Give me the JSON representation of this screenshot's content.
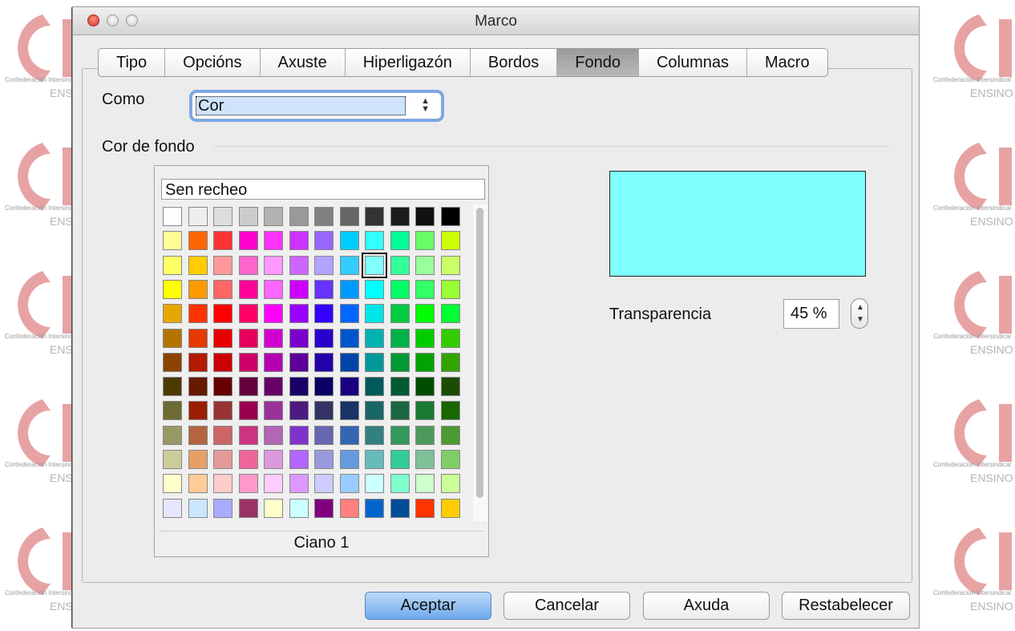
{
  "window": {
    "title": "Marco"
  },
  "tabs": [
    {
      "label": "Tipo",
      "active": false
    },
    {
      "label": "Opcións",
      "active": false
    },
    {
      "label": "Axuste",
      "active": false
    },
    {
      "label": "Hiperligazón",
      "active": false
    },
    {
      "label": "Bordos",
      "active": false
    },
    {
      "label": "Fondo",
      "active": true
    },
    {
      "label": "Columnas",
      "active": false
    },
    {
      "label": "Macro",
      "active": false
    }
  ],
  "como": {
    "label": "Como",
    "value": "Cor"
  },
  "section": {
    "title": "Cor de fondo"
  },
  "palette": {
    "none_label": "Sen recheo",
    "selected_name": "Ciano 1",
    "selected_index": [
      2,
      8
    ],
    "rows": [
      [
        "#ffffff",
        "#eeeeee",
        "#dddddd",
        "#cccccc",
        "#b2b2b2",
        "#999999",
        "#808080",
        "#666666",
        "#333333",
        "#1c1c1c",
        "#111111",
        "#000000"
      ],
      [
        "#ffff99",
        "#ff6600",
        "#ff3333",
        "#ff00cc",
        "#ff33ff",
        "#cc33ff",
        "#9966ff",
        "#00ccff",
        "#33ffff",
        "#00ff99",
        "#66ff66",
        "#ccff00"
      ],
      [
        "#ffff66",
        "#ffcc00",
        "#ff9999",
        "#ff66cc",
        "#ff99ff",
        "#cc66ff",
        "#b2a3ff",
        "#33ccff",
        "#80ffff",
        "#33ff99",
        "#99ff99",
        "#ccff66"
      ],
      [
        "#ffff00",
        "#ff9900",
        "#ff6666",
        "#ff0099",
        "#ff66ff",
        "#cc00ff",
        "#6633ff",
        "#0099ff",
        "#00ffff",
        "#00ff66",
        "#33ff66",
        "#99ff33"
      ],
      [
        "#e6a800",
        "#ff3300",
        "#ff0000",
        "#ff0066",
        "#ff00ff",
        "#9900ff",
        "#3300ff",
        "#0066ff",
        "#00e5e5",
        "#00cc44",
        "#00ff00",
        "#00ff33"
      ],
      [
        "#b37400",
        "#e63900",
        "#e60000",
        "#e6005c",
        "#d100d1",
        "#7a00cc",
        "#2a00cc",
        "#0055cc",
        "#00b2b2",
        "#00b247",
        "#00cc00",
        "#33cc00"
      ],
      [
        "#8a4400",
        "#b31a00",
        "#cc0000",
        "#cc0066",
        "#b300b3",
        "#5c0099",
        "#2200aa",
        "#0044aa",
        "#009999",
        "#009933",
        "#00a300",
        "#33a300"
      ],
      [
        "#4d3a00",
        "#661a00",
        "#660000",
        "#66003d",
        "#660066",
        "#1a0066",
        "#0a0066",
        "#1a0080",
        "#00595b",
        "#005a33",
        "#004d00",
        "#1a4d00"
      ],
      [
        "#6b6b33",
        "#991f00",
        "#993333",
        "#99004d",
        "#993399",
        "#4d1a80",
        "#333366",
        "#1a3366",
        "#1a6666",
        "#1a6640",
        "#1a7a33",
        "#1a6600"
      ],
      [
        "#999966",
        "#b3663d",
        "#cc6666",
        "#cc3380",
        "#b366b3",
        "#8033cc",
        "#6666b3",
        "#3366b3",
        "#338080",
        "#33995c",
        "#4d995c",
        "#4d9933"
      ],
      [
        "#cccc99",
        "#e6a066",
        "#e69999",
        "#ee6699",
        "#dd99dd",
        "#b366ff",
        "#9999dd",
        "#6699dd",
        "#66bbbb",
        "#33cc99",
        "#80c099",
        "#80cc66"
      ],
      [
        "#ffffcc",
        "#ffcc99",
        "#ffcccc",
        "#ff99cc",
        "#ffccff",
        "#dd99ff",
        "#ccccff",
        "#99ccff",
        "#ccffff",
        "#80ffcc",
        "#ccffcc",
        "#ccff99"
      ],
      [
        "#e6e6ff",
        "#cce6ff",
        "#aaaaff",
        "#993366",
        "#ffffcc",
        "#ccffff",
        "#800080",
        "#ff8080",
        "#0066cc",
        "#004c99",
        "#ff3300",
        "#ffcc00"
      ]
    ]
  },
  "preview": {
    "color": "#80ffff"
  },
  "transparency": {
    "label": "Transparencia",
    "value": "45 %"
  },
  "buttons": {
    "ok": "Aceptar",
    "cancel": "Cancelar",
    "help": "Axuda",
    "reset": "Restabelecer"
  },
  "watermark": {
    "line1": "Confederación Intersindical",
    "line2": "ENSINO"
  },
  "icons": [
    "close-icon",
    "minimize-icon",
    "zoom-icon",
    "select-arrows-icon",
    "stepper-arrows-icon"
  ]
}
